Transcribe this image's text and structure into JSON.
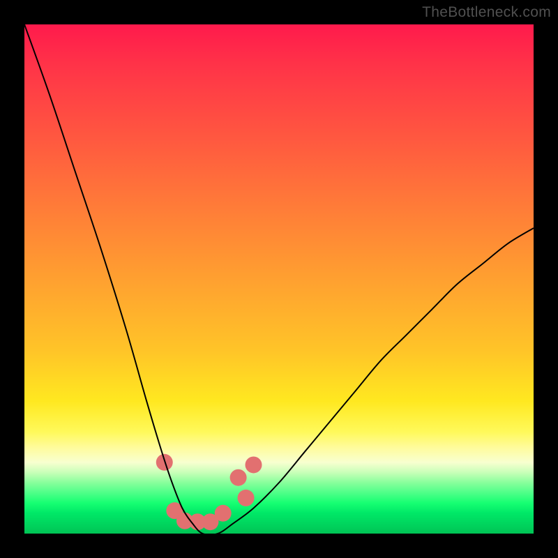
{
  "watermark": "TheBottleneck.com",
  "chart_data": {
    "type": "line",
    "title": "",
    "xlabel": "",
    "ylabel": "",
    "xlim": [
      0,
      100
    ],
    "ylim": [
      0,
      100
    ],
    "series": [
      {
        "name": "bottleneck-curve",
        "x": [
          0,
          5,
          10,
          15,
          20,
          24,
          27,
          29,
          31,
          33,
          35,
          38,
          41,
          45,
          50,
          55,
          60,
          65,
          70,
          75,
          80,
          85,
          90,
          95,
          100
        ],
        "y": [
          100,
          86,
          71,
          56,
          40,
          26,
          16,
          10,
          5,
          2,
          0,
          0,
          2,
          5,
          10,
          16,
          22,
          28,
          34,
          39,
          44,
          49,
          53,
          57,
          60
        ]
      }
    ],
    "markers": [
      {
        "x": 27.5,
        "y": 14.0
      },
      {
        "x": 29.5,
        "y": 4.5
      },
      {
        "x": 31.5,
        "y": 2.5
      },
      {
        "x": 34.0,
        "y": 2.3
      },
      {
        "x": 36.5,
        "y": 2.3
      },
      {
        "x": 39.0,
        "y": 4.0
      },
      {
        "x": 42.0,
        "y": 11.0
      },
      {
        "x": 43.5,
        "y": 7.0
      },
      {
        "x": 45.0,
        "y": 13.5
      }
    ],
    "marker_color": "#e27070",
    "marker_radius": 12,
    "curve_color": "#000000",
    "curve_width": 2
  }
}
